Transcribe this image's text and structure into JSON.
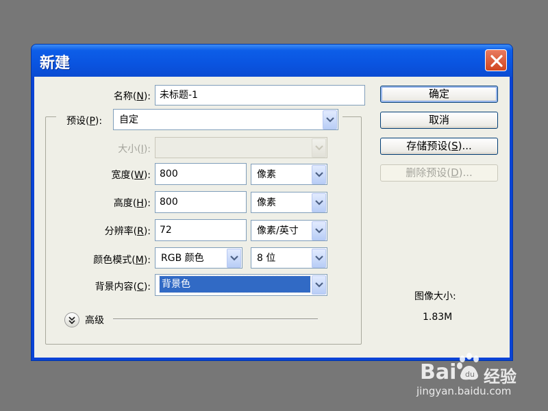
{
  "dialog": {
    "title": "新建",
    "close_label": "close"
  },
  "form": {
    "name": {
      "label": "名称",
      "key": "N",
      "value": "未标题-1"
    },
    "preset": {
      "label": "预设",
      "key": "P",
      "value": "自定"
    },
    "size": {
      "label": "大小",
      "key": "I",
      "value": ""
    },
    "width": {
      "label": "宽度",
      "key": "W",
      "value": "800",
      "unit": "像素"
    },
    "height": {
      "label": "高度",
      "key": "H",
      "value": "800",
      "unit": "像素"
    },
    "resolution": {
      "label": "分辨率",
      "key": "R",
      "value": "72",
      "unit": "像素/英寸"
    },
    "color_mode": {
      "label": "颜色模式",
      "key": "M",
      "value": "RGB 颜色",
      "depth": "8 位"
    },
    "background": {
      "label": "背景内容",
      "key": "C",
      "value": "背景色"
    },
    "advanced": {
      "label": "高级"
    }
  },
  "buttons": {
    "ok": {
      "label": "确定"
    },
    "cancel": {
      "label": "取消"
    },
    "save_preset": {
      "label": "存储预设",
      "key": "S",
      "suffix": "..."
    },
    "delete_preset": {
      "label": "删除预设",
      "key": "D",
      "suffix": "..."
    }
  },
  "image_size": {
    "label": "图像大小:",
    "value": "1.83M"
  },
  "watermark": {
    "brand": "Bai",
    "brand2": "经验",
    "url": "jingyan.baidu.com"
  },
  "colors": {
    "titlebar": "#0a54e0",
    "client": "#efefe7",
    "selection": "#316ac5"
  }
}
